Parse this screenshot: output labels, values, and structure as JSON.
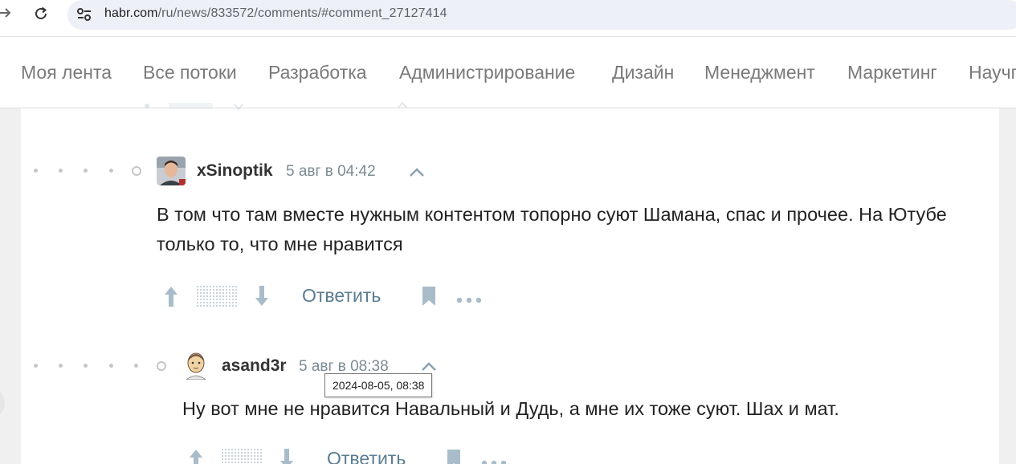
{
  "browser": {
    "url_domain": "habr.com",
    "url_path": "/ru/news/833572/comments/#comment_27127414",
    "back_icon": "arrow-right-icon",
    "reload_icon": "reload-icon",
    "site_settings_icon": "tune-icon"
  },
  "hubs": [
    {
      "label": "Моя лента"
    },
    {
      "label": "Все потоки"
    },
    {
      "label": "Разработка"
    },
    {
      "label": "Администрирование"
    },
    {
      "label": "Дизайн"
    },
    {
      "label": "Менеджмент"
    },
    {
      "label": "Маркетинг"
    },
    {
      "label": "Научпоп"
    }
  ],
  "comments": [
    {
      "author": "xSinoptik",
      "time": "5 авг в 04:42",
      "text": "В том что там вместе нужным контентом топорно суют Шамана, спас и прочее. На Ютубе только то, что мне нравится",
      "reply_label": "Ответить"
    },
    {
      "author": "asand3r",
      "time": "5 авг в 08:38",
      "text": "Ну вот мне не нравится Навальный и Дудь, а мне их тоже суют. Шах и мат.",
      "reply_label": "Ответить",
      "tooltip": "2024-08-05, 08:38"
    }
  ],
  "colors": {
    "accent_link": "#5a7d92",
    "hub_text": "#7a7a7a",
    "muted_icon": "#a8bcc9"
  }
}
